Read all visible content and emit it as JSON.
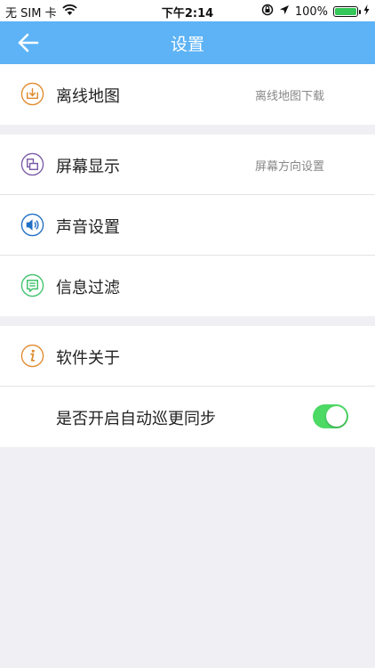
{
  "status_bar": {
    "carrier": "无 SIM 卡",
    "time": "下午2:14",
    "battery_percent": "100%",
    "battery_level": 1.0
  },
  "nav": {
    "title": "设置"
  },
  "settings": {
    "offline_map": {
      "label": "离线地图",
      "detail": "离线地图下载",
      "icon": "download-tray-icon",
      "color": "#e08a2e"
    },
    "screen_display": {
      "label": "屏幕显示",
      "detail": "屏幕方向设置",
      "icon": "screen-display-icon",
      "color": "#7b5ba8"
    },
    "sound_settings": {
      "label": "声音设置",
      "icon": "speaker-icon",
      "color": "#1f6fc4"
    },
    "message_filter": {
      "label": "信息过滤",
      "icon": "message-icon",
      "color": "#3fc26b"
    },
    "about": {
      "label": "软件关于",
      "icon": "info-icon",
      "color": "#e08a2e"
    },
    "auto_sync": {
      "label": "是否开启自动巡更同步",
      "enabled": true,
      "color": "#4cd964"
    }
  }
}
